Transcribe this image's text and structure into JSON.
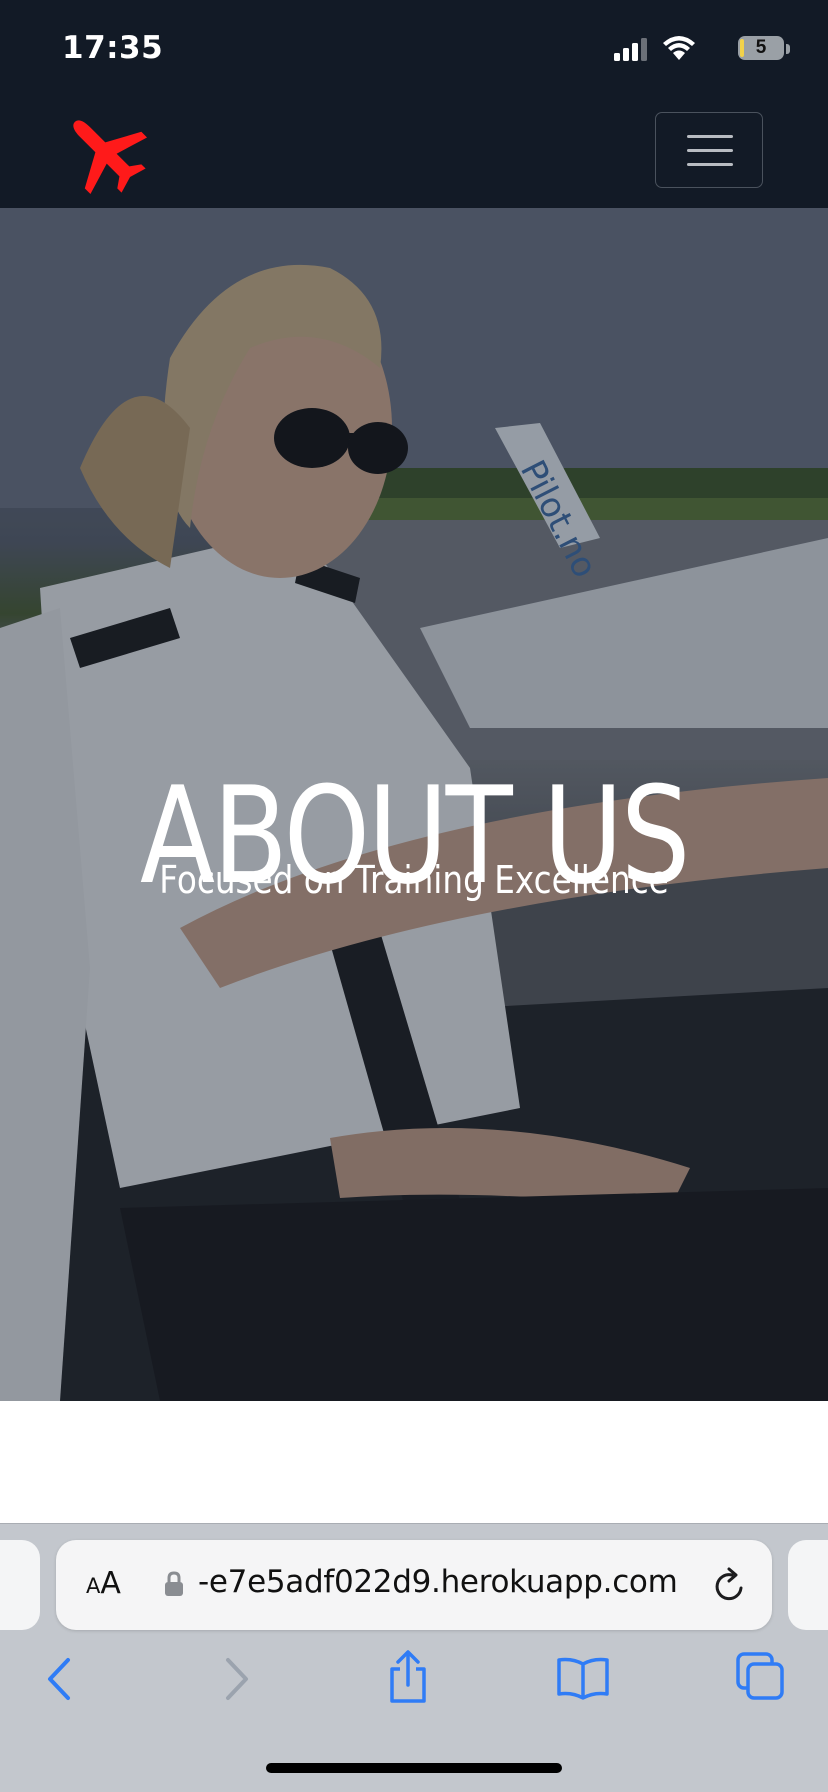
{
  "status_bar": {
    "time": "17:35",
    "battery_level": "5",
    "icons": [
      "signal-icon",
      "wifi-icon",
      "battery-icon"
    ]
  },
  "navbar": {
    "logo_icon": "airplane-icon",
    "logo_color": "#ff1a1a",
    "menu_icon": "hamburger-icon"
  },
  "hero": {
    "title": "ABOUT US",
    "subtitle": "Focused on Training Excellence",
    "background_photo": "pilot-in-cockpit-photo"
  },
  "browser": {
    "text_size_label_small": "A",
    "text_size_label_large": "A",
    "url": "-e7e5adf022d9.herokuapp.com",
    "accent_color": "#2f7cf6",
    "toolbar_icons": [
      "back-icon",
      "forward-icon",
      "share-icon",
      "bookmarks-icon",
      "tabs-icon"
    ]
  },
  "colors": {
    "header_bg": "#121a26",
    "toolbar_bg": "#c3c7cd"
  }
}
